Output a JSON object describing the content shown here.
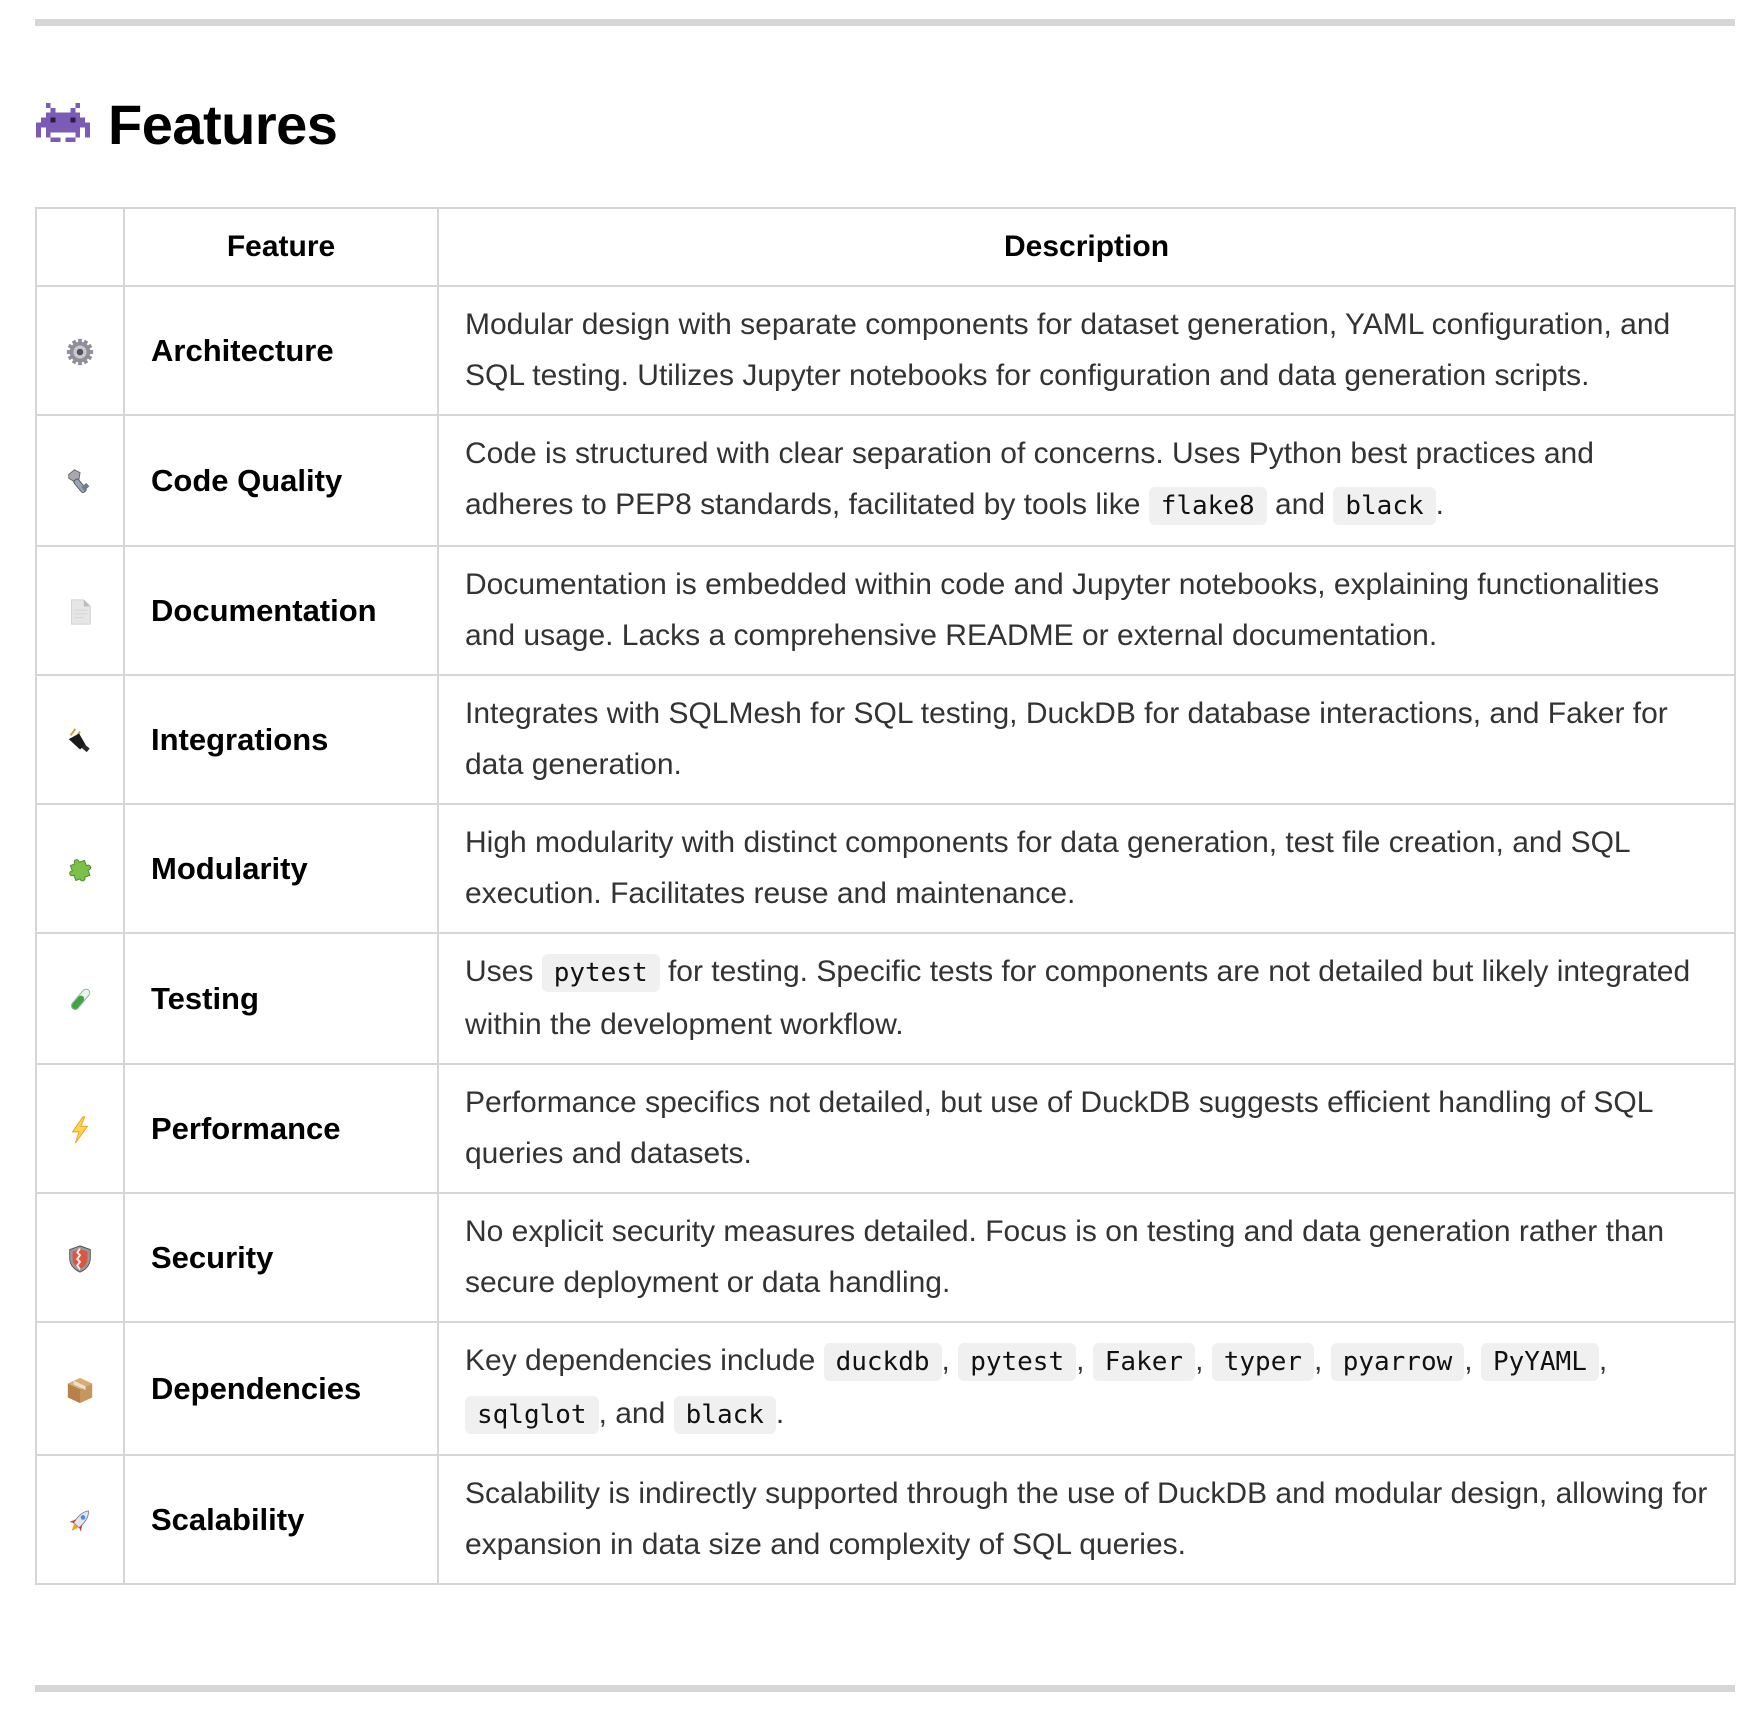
{
  "section": {
    "title": "Features",
    "title_icon": "space-invader-icon"
  },
  "table": {
    "headers": [
      "",
      "Feature",
      "Description"
    ],
    "rows": [
      {
        "icon": "gear-icon",
        "feature": "Architecture",
        "description": [
          {
            "t": "text",
            "v": "Modular design with separate components for dataset generation, YAML configuration, and SQL testing. Utilizes Jupyter notebooks for configuration and data generation scripts."
          }
        ]
      },
      {
        "icon": "nut-and-bolt-icon",
        "feature": "Code Quality",
        "description": [
          {
            "t": "text",
            "v": "Code is structured with clear separation of concerns. Uses Python best practices and adheres to PEP8 standards, facilitated by tools like "
          },
          {
            "t": "code",
            "v": "flake8"
          },
          {
            "t": "text",
            "v": " and "
          },
          {
            "t": "code",
            "v": "black"
          },
          {
            "t": "text",
            "v": "."
          }
        ]
      },
      {
        "icon": "document-icon",
        "feature": "Documentation",
        "description": [
          {
            "t": "text",
            "v": "Documentation is embedded within code and Jupyter notebooks, explaining functionalities and usage. Lacks a comprehensive README or external documentation."
          }
        ]
      },
      {
        "icon": "plug-icon",
        "feature": "Integrations",
        "description": [
          {
            "t": "text",
            "v": "Integrates with SQLMesh for SQL testing, DuckDB for database interactions, and Faker for data generation."
          }
        ]
      },
      {
        "icon": "puzzle-piece-icon",
        "feature": "Modularity",
        "description": [
          {
            "t": "text",
            "v": "High modularity with distinct components for data generation, test file creation, and SQL execution. Facilitates reuse and maintenance."
          }
        ]
      },
      {
        "icon": "test-tube-icon",
        "feature": "Testing",
        "description": [
          {
            "t": "text",
            "v": "Uses "
          },
          {
            "t": "code",
            "v": "pytest"
          },
          {
            "t": "text",
            "v": " for testing. Specific tests for components are not detailed but likely integrated within the development workflow."
          }
        ]
      },
      {
        "icon": "lightning-bolt-icon",
        "feature": "Performance",
        "description": [
          {
            "t": "text",
            "v": "Performance specifics not detailed, but use of DuckDB suggests efficient handling of SQL queries and datasets."
          }
        ]
      },
      {
        "icon": "shield-icon",
        "feature": "Security",
        "description": [
          {
            "t": "text",
            "v": "No explicit security measures detailed. Focus is on testing and data generation rather than secure deployment or data handling."
          }
        ]
      },
      {
        "icon": "package-icon",
        "feature": "Dependencies",
        "description": [
          {
            "t": "text",
            "v": "Key dependencies include "
          },
          {
            "t": "code",
            "v": "duckdb"
          },
          {
            "t": "text",
            "v": ", "
          },
          {
            "t": "code",
            "v": "pytest"
          },
          {
            "t": "text",
            "v": ", "
          },
          {
            "t": "code",
            "v": "Faker"
          },
          {
            "t": "text",
            "v": ", "
          },
          {
            "t": "code",
            "v": "typer"
          },
          {
            "t": "text",
            "v": ", "
          },
          {
            "t": "code",
            "v": "pyarrow"
          },
          {
            "t": "text",
            "v": ", "
          },
          {
            "t": "code",
            "v": "PyYAML"
          },
          {
            "t": "text",
            "v": ", "
          },
          {
            "t": "code",
            "v": "sqlglot"
          },
          {
            "t": "text",
            "v": ", and "
          },
          {
            "t": "code",
            "v": "black"
          },
          {
            "t": "text",
            "v": "."
          }
        ]
      },
      {
        "icon": "rocket-icon",
        "feature": "Scalability",
        "description": [
          {
            "t": "text",
            "v": "Scalability is indirectly supported through the use of DuckDB and modular design, allowing for expansion in data size and complexity of SQL queries."
          }
        ]
      }
    ]
  },
  "colors": {
    "rule": "#d6d6d6",
    "border": "#d6d6d6",
    "code_bg": "#f0f0f0",
    "body_text": "#333333",
    "heading_text": "#000000"
  }
}
